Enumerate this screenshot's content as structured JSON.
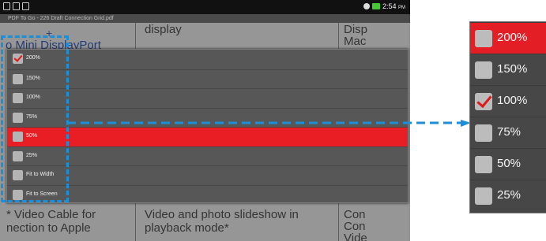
{
  "status_bar": {
    "time": "2:54",
    "time_suffix": "PM"
  },
  "title_bar": {
    "filename": "PDF To Go - 226 Draft Connection Grid.pdf"
  },
  "document": {
    "cells": {
      "top_mid": "display",
      "top_right_1": "Disp",
      "top_right_2": "Mac",
      "left_link": "o Mini DisplayPort",
      "plus": "+",
      "bottom_left_1": "* Video Cable for",
      "bottom_left_2": "nection to Apple",
      "bottom_mid_1": "Video and photo slideshow in",
      "bottom_mid_2": "playback mode*",
      "bottom_right_1": "Con",
      "bottom_right_2": "Con",
      "bottom_right_3": "Vide"
    }
  },
  "zoom_menu": {
    "items": [
      {
        "label": "200%",
        "checked": true,
        "selected": false
      },
      {
        "label": "150%",
        "checked": false,
        "selected": false
      },
      {
        "label": "100%",
        "checked": false,
        "selected": false
      },
      {
        "label": "75%",
        "checked": false,
        "selected": false
      },
      {
        "label": "50%",
        "checked": false,
        "selected": true
      },
      {
        "label": "25%",
        "checked": false,
        "selected": false
      },
      {
        "label": "Fit to Width",
        "checked": false,
        "selected": false
      },
      {
        "label": "Fit to Screen",
        "checked": false,
        "selected": false
      }
    ]
  },
  "zoom_panel": {
    "items": [
      {
        "label": "200%",
        "checked": false,
        "selected": true
      },
      {
        "label": "150%",
        "checked": false,
        "selected": false
      },
      {
        "label": "100%",
        "checked": true,
        "selected": false
      },
      {
        "label": "75%",
        "checked": false,
        "selected": false
      },
      {
        "label": "50%",
        "checked": false,
        "selected": false
      },
      {
        "label": "25%",
        "checked": false,
        "selected": false
      }
    ]
  },
  "colors": {
    "highlight_red": "#e91e24",
    "callout_blue": "#1c8fd6",
    "check_red": "#e01818"
  }
}
